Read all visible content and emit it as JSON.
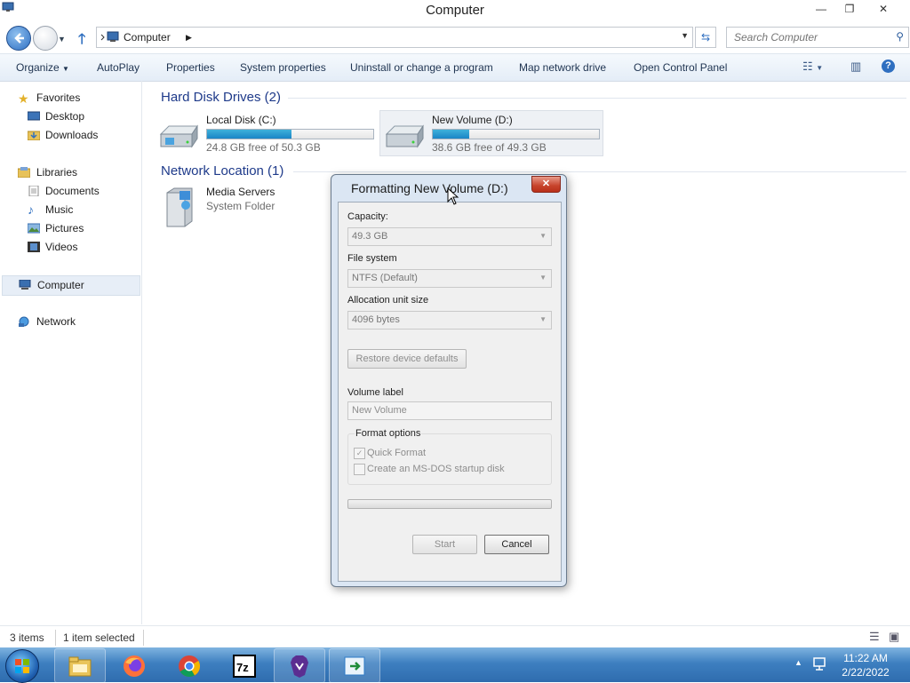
{
  "window": {
    "title": "Computer"
  },
  "address": {
    "crumbs": [
      "Computer"
    ],
    "search_placeholder": "Search Computer"
  },
  "toolbar": {
    "items": [
      "Organize",
      "AutoPlay",
      "Properties",
      "System properties",
      "Uninstall or change a program",
      "Map network drive",
      "Open Control Panel"
    ]
  },
  "sidebar": {
    "favorites": "Favorites",
    "favorites_items": [
      "Desktop",
      "Downloads"
    ],
    "libraries": "Libraries",
    "libraries_items": [
      "Documents",
      "Music",
      "Pictures",
      "Videos"
    ],
    "computer": "Computer",
    "network": "Network"
  },
  "content": {
    "hdd_group": "Hard Disk Drives (2)",
    "net_group": "Network Location (1)",
    "drives": [
      {
        "name": "Local Disk (C:)",
        "free": "24.8 GB free of 50.3 GB",
        "used_fraction": 0.51
      },
      {
        "name": "New Volume (D:)",
        "free": "38.6 GB free of 49.3 GB",
        "used_fraction": 0.22
      }
    ],
    "network_item": {
      "name": "Media Servers",
      "type": "System Folder"
    }
  },
  "status": {
    "items": "3 items",
    "selected": "1 item selected"
  },
  "dialog": {
    "title": "Formatting New Volume (D:)",
    "capacity_label": "Capacity:",
    "capacity_value": "49.3 GB",
    "fs_label": "File system",
    "fs_value": "NTFS (Default)",
    "alloc_label": "Allocation unit size",
    "alloc_value": "4096 bytes",
    "restore_button": "Restore device defaults",
    "volume_label": "Volume label",
    "volume_value": "New Volume",
    "format_options": "Format options",
    "quick_format": "Quick Format",
    "msdos": "Create an MS-DOS startup disk",
    "start_button": "Start",
    "cancel_button": "Cancel",
    "progress": 0
  },
  "taskbar": {
    "time": "11:22 AM",
    "date": "2/22/2022"
  },
  "colors": {
    "accent": "#1a85c6",
    "taskbar": "#3d7fc0",
    "group_heading": "#1e3a8a"
  }
}
